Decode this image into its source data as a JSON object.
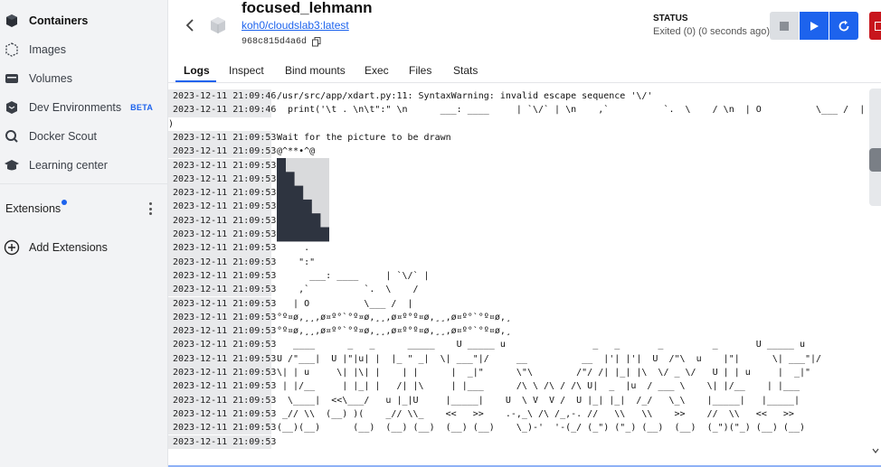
{
  "sidebar": {
    "items": [
      {
        "label": "Containers",
        "icon": "containers-icon",
        "active": true
      },
      {
        "label": "Images",
        "icon": "images-icon"
      },
      {
        "label": "Volumes",
        "icon": "volumes-icon"
      },
      {
        "label": "Dev Environments",
        "icon": "dev-environments-icon",
        "badge": "BETA"
      },
      {
        "label": "Docker Scout",
        "icon": "docker-scout-icon"
      },
      {
        "label": "Learning center",
        "icon": "learning-center-icon"
      }
    ],
    "extensions_label": "Extensions",
    "add_extensions_label": "Add Extensions"
  },
  "container": {
    "name": "focused_lehmann",
    "image": "koh0/cloudslab3:latest",
    "id": "968c815d4a6d",
    "status_label": "STATUS",
    "status_value": "Exited (0) (0 seconds ago)"
  },
  "tabs": [
    "Logs",
    "Inspect",
    "Bind mounts",
    "Exec",
    "Files",
    "Stats"
  ],
  "active_tab": "Logs",
  "logs": [
    {
      "ts": "2023-12-11 21:09:46",
      "msg": "/usr/src/app/xdart.py:11: SyntaxWarning: invalid escape sequence '\\/'"
    },
    {
      "ts": "2023-12-11 21:09:46",
      "msg": "  print('\\t . \\n\\t\":\" \\n      ___: ____     | `\\/` | \\n    ,`          `.  \\    / \\n  | O          \\___ /  | '"
    },
    {
      "ts": "",
      "msg": ")"
    },
    {
      "ts": "2023-12-11 21:09:53",
      "msg": "Wait for the picture to be drawn"
    },
    {
      "ts": "2023-12-11 21:09:53",
      "msg": "@^**•^@"
    },
    {
      "ts": "2023-12-11 21:09:53",
      "msg": ""
    },
    {
      "ts": "2023-12-11 21:09:53",
      "msg": ""
    },
    {
      "ts": "2023-12-11 21:09:53",
      "msg": ""
    },
    {
      "ts": "2023-12-11 21:09:53",
      "msg": ""
    },
    {
      "ts": "2023-12-11 21:09:53",
      "msg": ""
    },
    {
      "ts": "2023-12-11 21:09:53",
      "msg": ""
    },
    {
      "ts": "2023-12-11 21:09:53",
      "msg": "     ."
    },
    {
      "ts": "2023-12-11 21:09:53",
      "msg": "    \":\""
    },
    {
      "ts": "2023-12-11 21:09:53",
      "msg": "      ___: ____     | `\\/` |"
    },
    {
      "ts": "2023-12-11 21:09:53",
      "msg": "    ,`          `.  \\    /"
    },
    {
      "ts": "2023-12-11 21:09:53",
      "msg": "   | O          \\___ /  |"
    },
    {
      "ts": "2023-12-11 21:09:53",
      "msg": "°º¤ø,¸¸,ø¤º°`°º¤ø,¸¸,ø¤º°º¤ø,¸¸,ø¤º°`°º¤ø,¸"
    },
    {
      "ts": "2023-12-11 21:09:53",
      "msg": "°º¤ø,¸¸,ø¤º°`°º¤ø,¸¸,ø¤º°º¤ø,¸¸,ø¤º°`°º¤ø,¸"
    },
    {
      "ts": "2023-12-11 21:09:53",
      "msg": "   ____      _   _      _____    U _____ u                _   _       _         _       U _____ u"
    },
    {
      "ts": "2023-12-11 21:09:53",
      "msg": "U /\"___|  U |\"|u| |  |_ \" _|  \\| ___\"|/     __          __  |'| |'|  U  /\"\\  u    |\"|      \\| ___\"|/"
    },
    {
      "ts": "2023-12-11 21:09:53",
      "msg": "\\| | u     \\| |\\| |    | |      |  _|\"      \\\"\\        /\"/ /| |_| |\\  \\/ _ \\/   U | | u     |  _|\""
    },
    {
      "ts": "2023-12-11 21:09:53",
      "msg": " | |/__     | |_| |   /| |\\     | |___      /\\ \\ /\\ / /\\ U|  _  |u  / ___ \\    \\| |/__    | |___"
    },
    {
      "ts": "2023-12-11 21:09:53",
      "msg": "  \\____|  <<\\___/   u |_|U     |_____|    U  \\ V  V /  U |_| |_|  /_/   \\_\\    |_____|   |_____|"
    },
    {
      "ts": "2023-12-11 21:09:53",
      "msg": " _// \\\\  (__) )(    _// \\\\_    <<   >>    .-,_\\ /\\ /_,-. //   \\\\   \\\\    >>    //  \\\\   <<   >>"
    },
    {
      "ts": "2023-12-11 21:09:53",
      "msg": "(__)(__)      (__)  (__) (__)  (__) (__)    \\_)-'  '-(_/ (_\") (\"_) (__)  (__)  (_\")(\"_) (__) (__)"
    },
    {
      "ts": "2023-12-11 21:09:53",
      "msg": ""
    }
  ],
  "colors": {
    "accent": "#1d63ed",
    "delete": "#c8161d",
    "sidebar_bg": "#f2f3f5"
  }
}
